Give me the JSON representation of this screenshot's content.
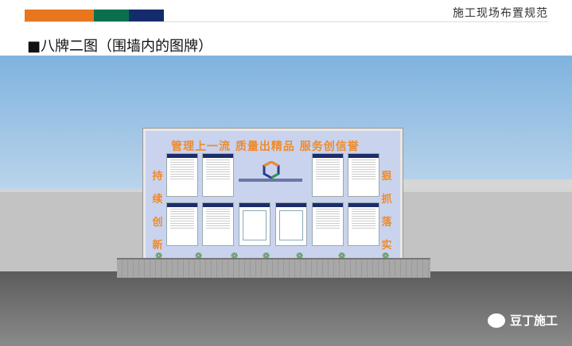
{
  "header": {
    "title": "施工现场布置规范",
    "brand_colors": [
      "#e8761e",
      "#08704e",
      "#142c6c"
    ]
  },
  "slide": {
    "title": "■八牌二图（围墙内的图牌）"
  },
  "billboard": {
    "slogan": "管理上一流  质量出精品  服务创信誉",
    "left_chars": [
      "持",
      "续",
      "创",
      "新"
    ],
    "right_chars": [
      "狠",
      "抓",
      "落",
      "实"
    ]
  },
  "watermark": {
    "text": "豆丁施工",
    "icon": "wechat-icon"
  }
}
